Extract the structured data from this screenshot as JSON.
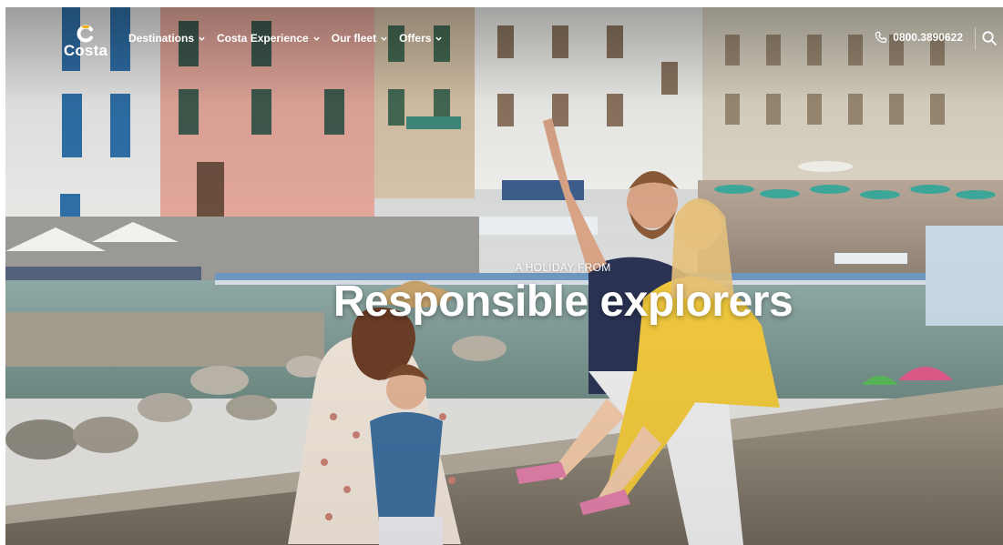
{
  "brand": {
    "name": "Costa",
    "logo_color": "#ffffff",
    "accent": "#f2b51f"
  },
  "nav": {
    "items": [
      {
        "label": "Destinations"
      },
      {
        "label": "Costa Experience"
      },
      {
        "label": "Our fleet"
      },
      {
        "label": "Offers"
      }
    ]
  },
  "header": {
    "phone": "0800.3890622",
    "icons": {
      "phone": "phone-icon",
      "search": "search-icon",
      "chevron": "chevron-down-icon"
    }
  },
  "hero": {
    "eyebrow": "A HOLIDAY FROM",
    "title": "Responsible explorers"
  }
}
